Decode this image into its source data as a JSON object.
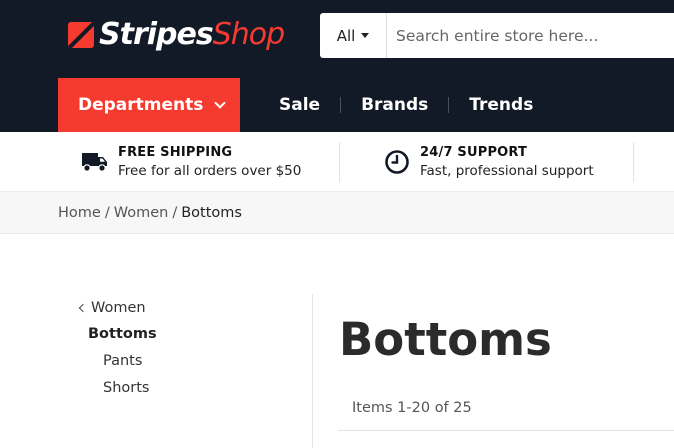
{
  "header": {
    "logo": {
      "part1": "Stripes",
      "part2": "Shop"
    },
    "search": {
      "category": "All",
      "placeholder": "Search entire store here..."
    },
    "departments_label": "Departments",
    "nav": [
      "Sale",
      "Brands",
      "Trends"
    ]
  },
  "features": [
    {
      "icon": "truck-icon",
      "title": "FREE SHIPPING",
      "subtitle": "Free for all orders over $50"
    },
    {
      "icon": "clock-icon",
      "title": "24/7 SUPPORT",
      "subtitle": "Fast, professional support"
    }
  ],
  "breadcrumb": [
    "Home",
    "Women",
    "Bottoms"
  ],
  "sidebar": {
    "parent": "Women",
    "current": "Bottoms",
    "children": [
      "Pants",
      "Shorts"
    ]
  },
  "main": {
    "title": "Bottoms",
    "count": "Items 1-20 of 25"
  },
  "colors": {
    "accent": "#f53b30",
    "header_bg": "#131a27"
  }
}
